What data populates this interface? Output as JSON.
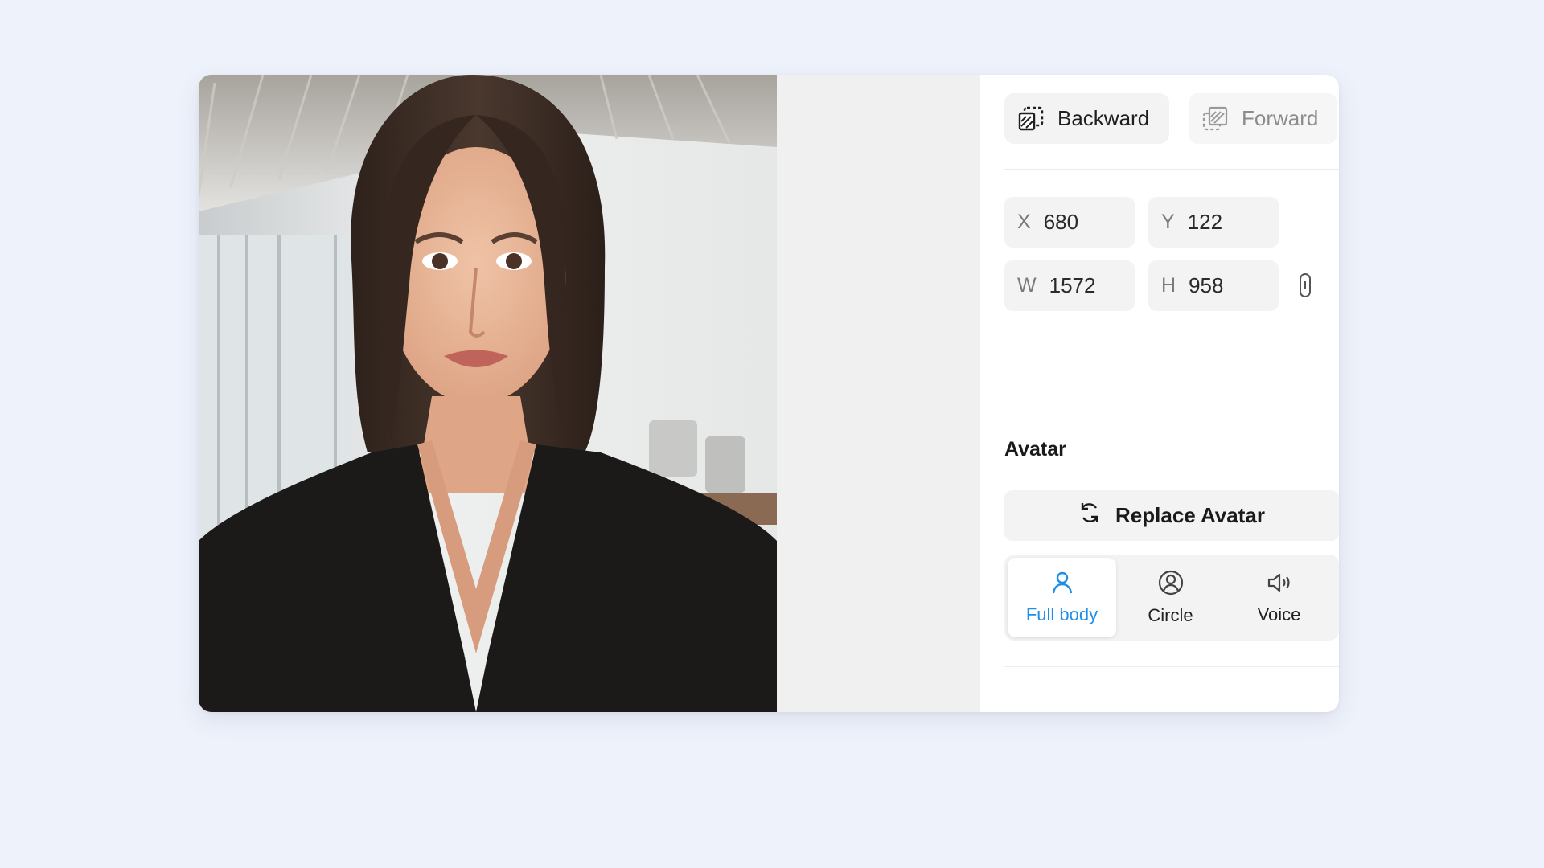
{
  "layer_order": {
    "backward_label": "Backward",
    "forward_label": "Forward"
  },
  "position": {
    "x_label": "X",
    "x_value": "680",
    "y_label": "Y",
    "y_value": "122",
    "w_label": "W",
    "w_value": "1572",
    "h_label": "H",
    "h_value": "958"
  },
  "avatar": {
    "section_title": "Avatar",
    "replace_label": "Replace Avatar",
    "styles": [
      {
        "label": "Full body",
        "icon": "person-icon",
        "active": true
      },
      {
        "label": "Circle",
        "icon": "person-circle-icon",
        "active": false
      },
      {
        "label": "Voice",
        "icon": "speaker-icon",
        "active": false
      }
    ]
  },
  "colors": {
    "active": "#1e8ee8",
    "page_bg": "#eef2fb"
  }
}
